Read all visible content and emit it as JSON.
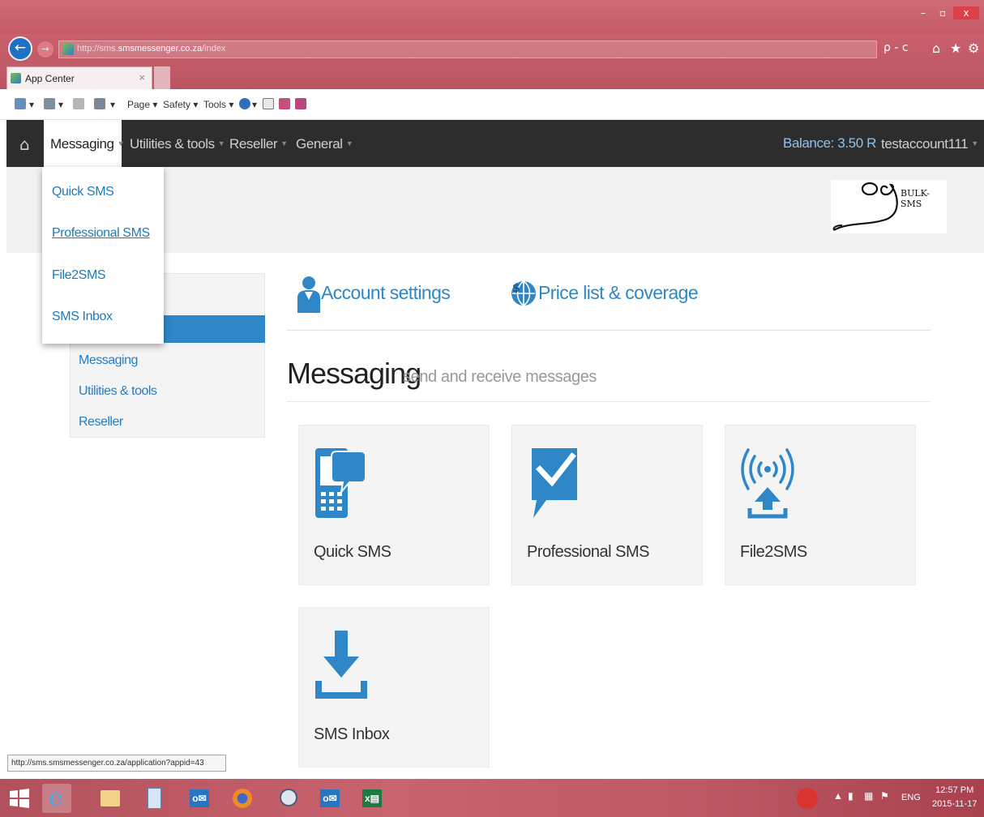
{
  "browser": {
    "url_domain": "http://sms.",
    "url_host": "smsmessenger.co.za",
    "url_path": "/index",
    "search_refresh": "ρ - c",
    "tab_title": "App Center",
    "tab_close": "×",
    "command_bar": {
      "page": "Page ▾",
      "safety": "Safety ▾",
      "tools": "Tools ▾"
    }
  },
  "window_controls": {
    "minimize": "–",
    "maximize": "▫",
    "close": "x"
  },
  "navbar": {
    "home_icon": "⌂",
    "items": [
      {
        "label": "Messaging",
        "caret": "▼"
      },
      {
        "label": "Utilities & tools",
        "caret": "▼"
      },
      {
        "label": "Reseller",
        "caret": "▼"
      },
      {
        "label": "General",
        "caret": "▼"
      }
    ],
    "balance": "Balance: 3.50 R",
    "user": "testaccount111",
    "user_caret": "▼"
  },
  "logo": {
    "text": "BULK-SMS"
  },
  "dropdown": {
    "items": [
      "Quick SMS",
      "Professional SMS",
      "File2SMS",
      "SMS Inbox"
    ]
  },
  "sidebar": {
    "links": [
      "Messaging",
      "Utilities & tools",
      "Reseller"
    ]
  },
  "quick_links": [
    {
      "label": "Account settings",
      "icon": "user-icon"
    },
    {
      "label": "Price list & coverage",
      "icon": "globe-dollar-icon"
    }
  ],
  "section": {
    "title": "Messaging",
    "subtitle": "send and receive messages"
  },
  "tiles": [
    {
      "label": "Quick SMS",
      "icon": "phone-chat-icon"
    },
    {
      "label": "Professional SMS",
      "icon": "chat-check-icon"
    },
    {
      "label": "File2SMS",
      "icon": "broadcast-upload-icon"
    },
    {
      "label": "SMS Inbox",
      "icon": "inbox-download-icon"
    }
  ],
  "status_bar": {
    "url": "http://sms.smsmessenger.co.za/application?appid=43"
  },
  "taskbar": {
    "lang": "ENG",
    "time": "12:57 PM",
    "date": "2015-11-17"
  },
  "colors": {
    "accent": "#2f87c8",
    "navbar": "#2d2d2d",
    "balance": "#8fc2ef",
    "chrome": "#c55a67"
  }
}
